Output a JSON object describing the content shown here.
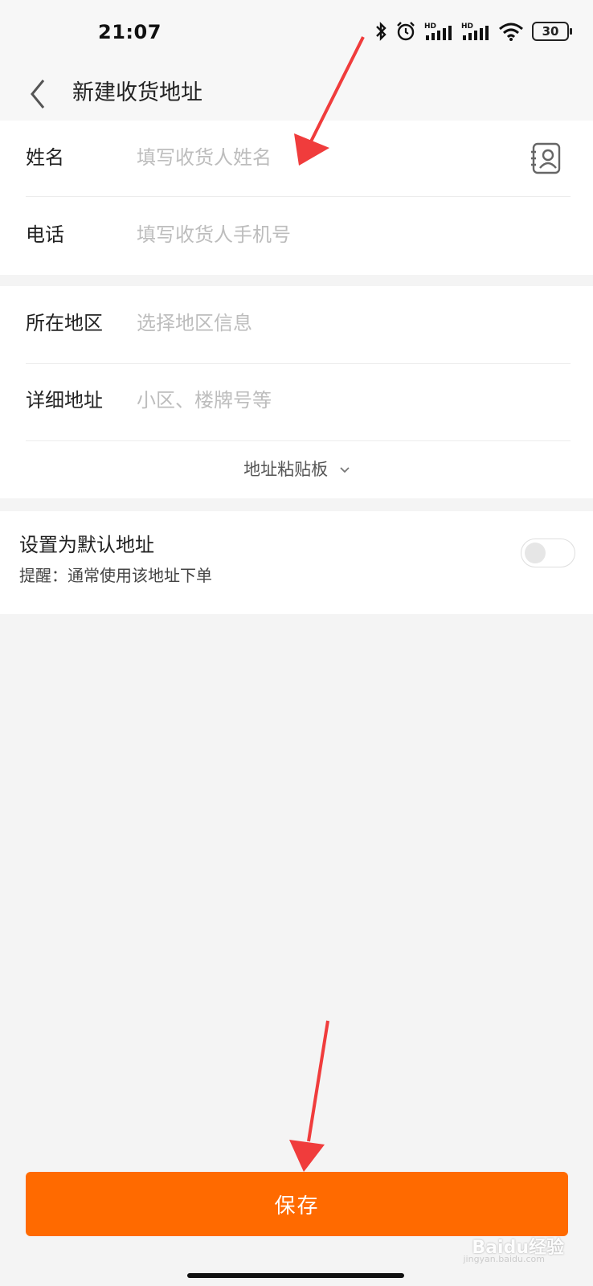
{
  "status_bar": {
    "time": "21:07",
    "battery": "30",
    "icons": [
      "bluetooth-icon",
      "alarm-icon",
      "hd-signal-icon",
      "hd-signal-icon",
      "wifi-icon",
      "battery-icon"
    ]
  },
  "header": {
    "title": "新建收货地址"
  },
  "form": {
    "name": {
      "label": "姓名",
      "placeholder": "填写收货人姓名"
    },
    "phone": {
      "label": "电话",
      "placeholder": "填写收货人手机号"
    },
    "region": {
      "label": "所在地区",
      "placeholder": "选择地区信息"
    },
    "detail": {
      "label": "详细地址",
      "placeholder": "小区、楼牌号等"
    },
    "paste_label": "地址粘贴板"
  },
  "default_address": {
    "title": "设置为默认地址",
    "hint": "提醒：通常使用该地址下单",
    "enabled": false
  },
  "save_label": "保存",
  "watermark": {
    "text": "Baidu经验",
    "sub": "jingyan.baidu.com"
  },
  "colors": {
    "accent": "#ff6a00",
    "annotation_arrow": "#f03c3c"
  }
}
